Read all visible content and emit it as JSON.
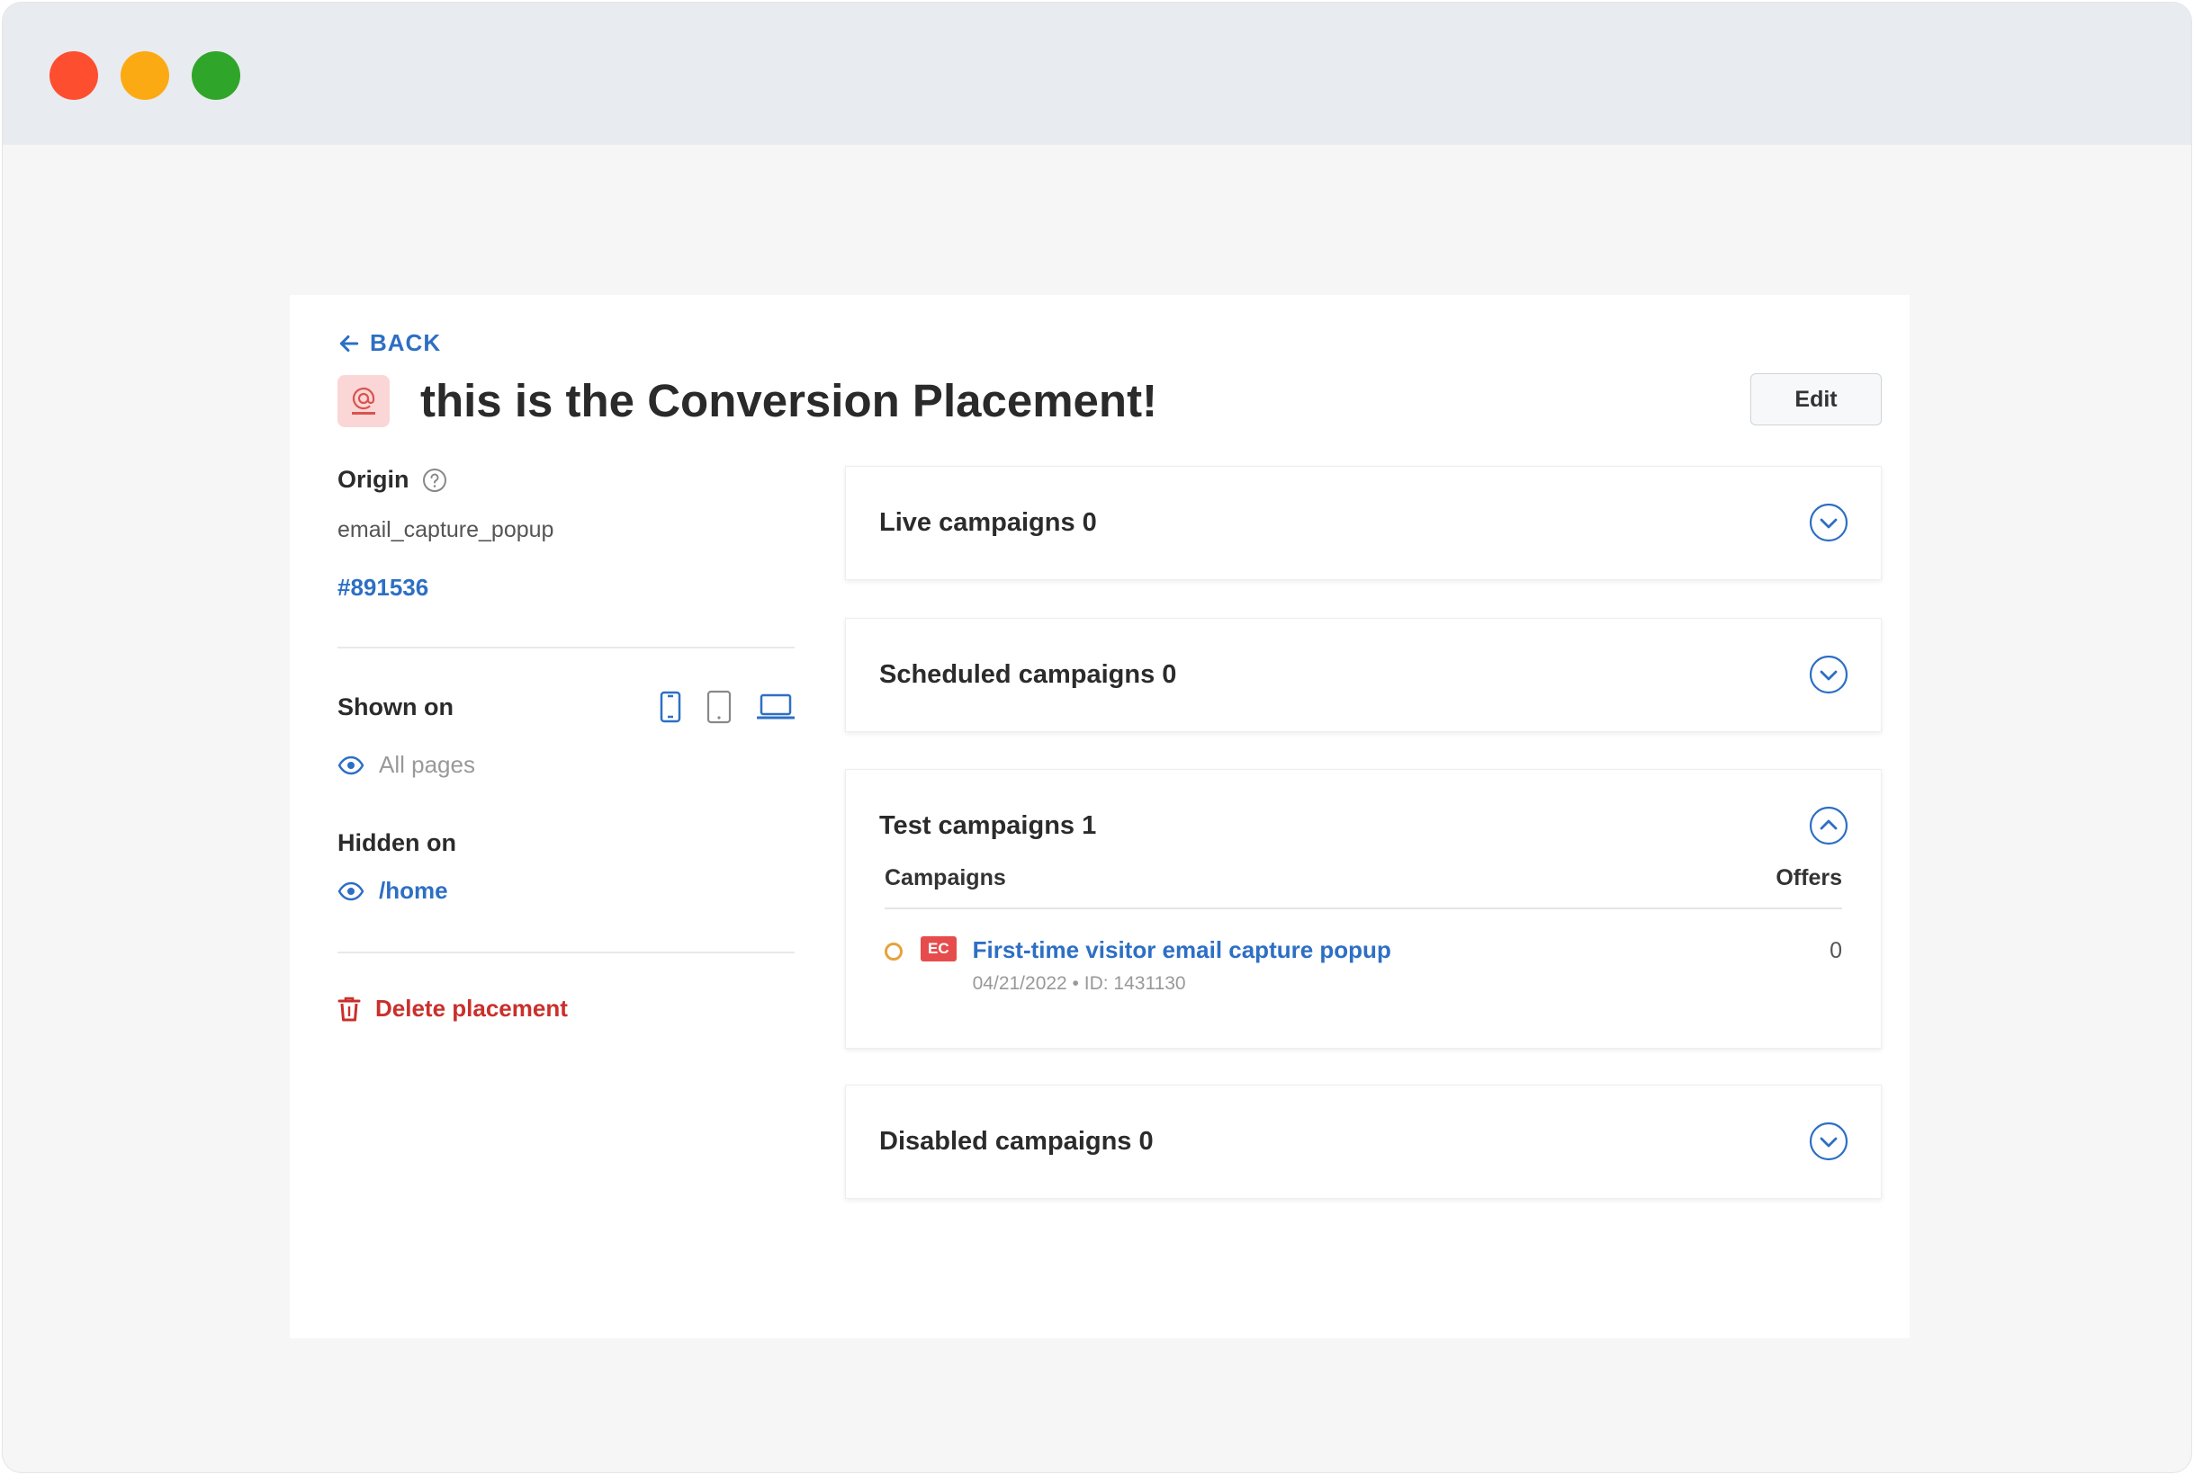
{
  "window": {
    "traffic_lights": [
      "close",
      "minimize",
      "maximize"
    ]
  },
  "nav": {
    "back_label": "BACK"
  },
  "placement": {
    "title": "this is the Conversion Placement!",
    "icon": "at-sign-icon",
    "edit_label": "Edit"
  },
  "details": {
    "origin_label": "Origin",
    "origin_value": "email_capture_popup",
    "origin_id": "#891536",
    "shown_on_label": "Shown on",
    "devices": [
      "mobile-icon",
      "tablet-icon",
      "laptop-icon"
    ],
    "shown_pages": [
      "All pages"
    ],
    "hidden_on_label": "Hidden on",
    "hidden_pages": [
      "/home"
    ],
    "delete_label": "Delete placement"
  },
  "panels": [
    {
      "title": "Live campaigns 0",
      "expanded": false
    },
    {
      "title": "Scheduled campaigns 0",
      "expanded": false
    },
    {
      "title": "Test campaigns 1",
      "expanded": true,
      "columns": [
        "Campaigns",
        "Offers"
      ],
      "rows": [
        {
          "badge": "EC",
          "name": "First-time visitor email capture popup",
          "meta": "04/21/2022 • ID: 1431130",
          "offers": "0"
        }
      ]
    },
    {
      "title": "Disabled campaigns 0",
      "expanded": false
    }
  ],
  "colors": {
    "accent": "#2d6fc4",
    "danger": "#c9302c",
    "status_test": "#e6a23c",
    "badge": "#e74c4c"
  }
}
